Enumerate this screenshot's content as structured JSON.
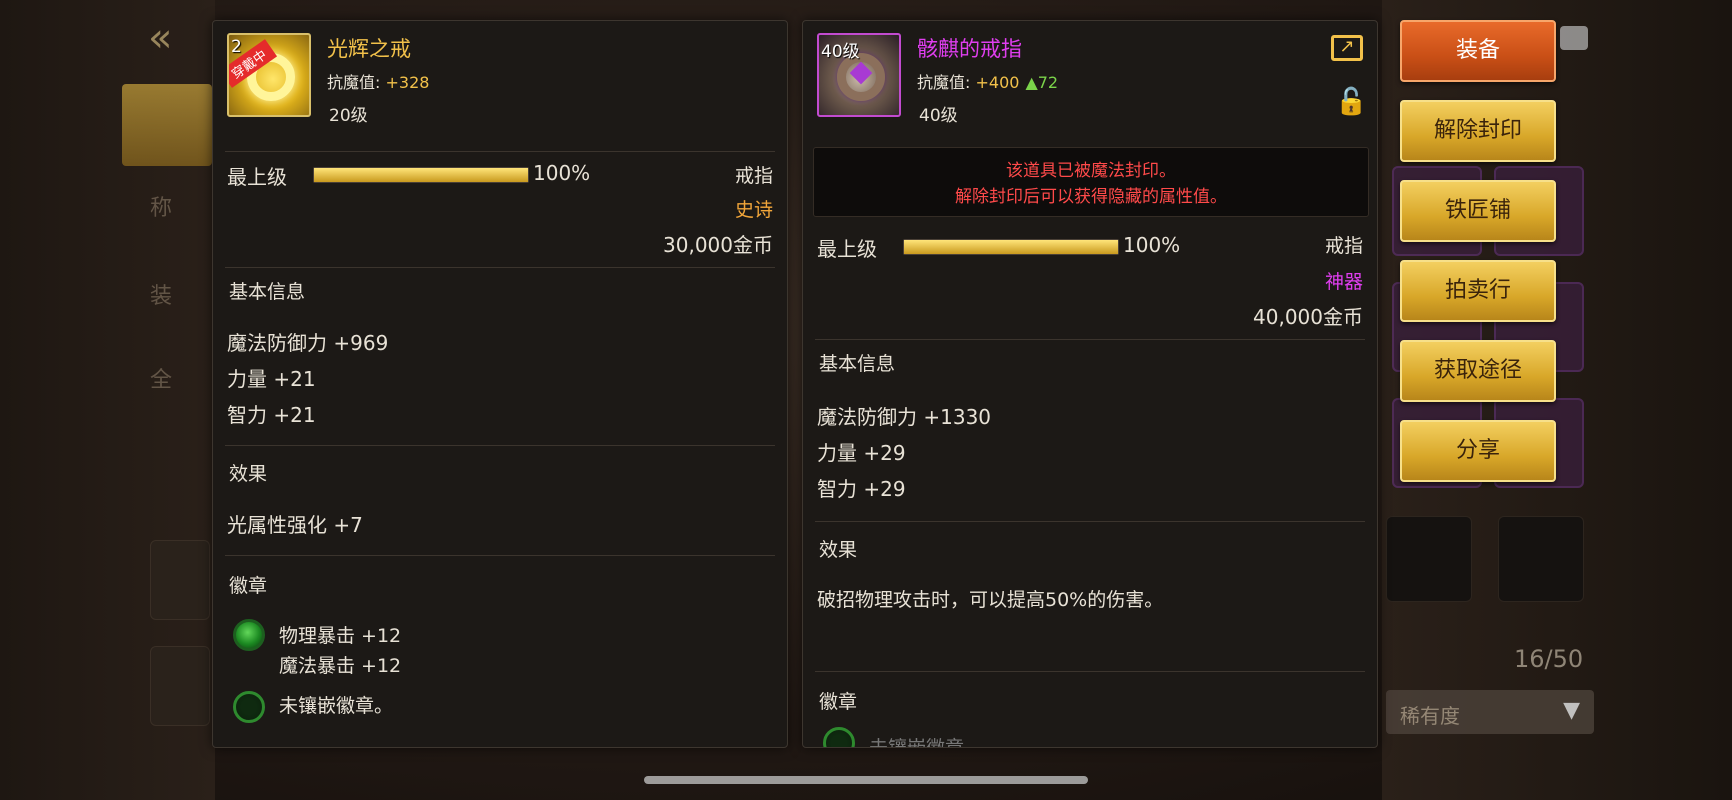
{
  "left_item": {
    "level_tag": "20级",
    "equipped_badge": "穿戴中",
    "name": "光辉之戒",
    "stat_label": "抗魔值:",
    "stat_value": " +328",
    "level": "20级",
    "grade": "最上级",
    "grade_progress_percent": 100,
    "grade_pct_text": "100%",
    "slot_type": "戒指",
    "rarity": "史诗",
    "price": "30,000金币",
    "basic_info_title": "基本信息",
    "basic_stats": [
      "魔法防御力 +969",
      "力量 +21",
      "智力 +21"
    ],
    "effect_title": "效果",
    "effects": [
      "光属性强化 +7"
    ],
    "emblem_title": "徽章",
    "emblem_slot_1_lines": [
      "物理暴击 +12",
      "魔法暴击 +12"
    ],
    "emblem_slot_2": "未镶嵌徽章。"
  },
  "right_item": {
    "level_tag": "40级",
    "name": "骸麒的戒指",
    "stat_label": "抗魔值:",
    "stat_value": " +400",
    "stat_delta": "▲72",
    "level": "40级",
    "seal_notice_line1": "该道具已被魔法封印。",
    "seal_notice_line2": "解除封印后可以获得隐藏的属性值。",
    "grade": "最上级",
    "grade_progress_percent": 100,
    "grade_pct_text": "100%",
    "slot_type": "戒指",
    "rarity": "神器",
    "price": "40,000金币",
    "basic_info_title": "基本信息",
    "basic_stats": [
      "魔法防御力 +1330",
      "力量 +29",
      "智力 +29"
    ],
    "effect_title": "效果",
    "effects": [
      "破招物理攻击时，可以提高50%的伤害。"
    ],
    "emblem_title": "徽章",
    "emblem_partial": "未镶嵌徽章。"
  },
  "actions": [
    "装备",
    "解除封印",
    "铁匠铺",
    "拍卖行",
    "获取途径",
    "分享"
  ],
  "background": {
    "inventory_count": "16/50",
    "sort_dropdown": "稀有度"
  }
}
